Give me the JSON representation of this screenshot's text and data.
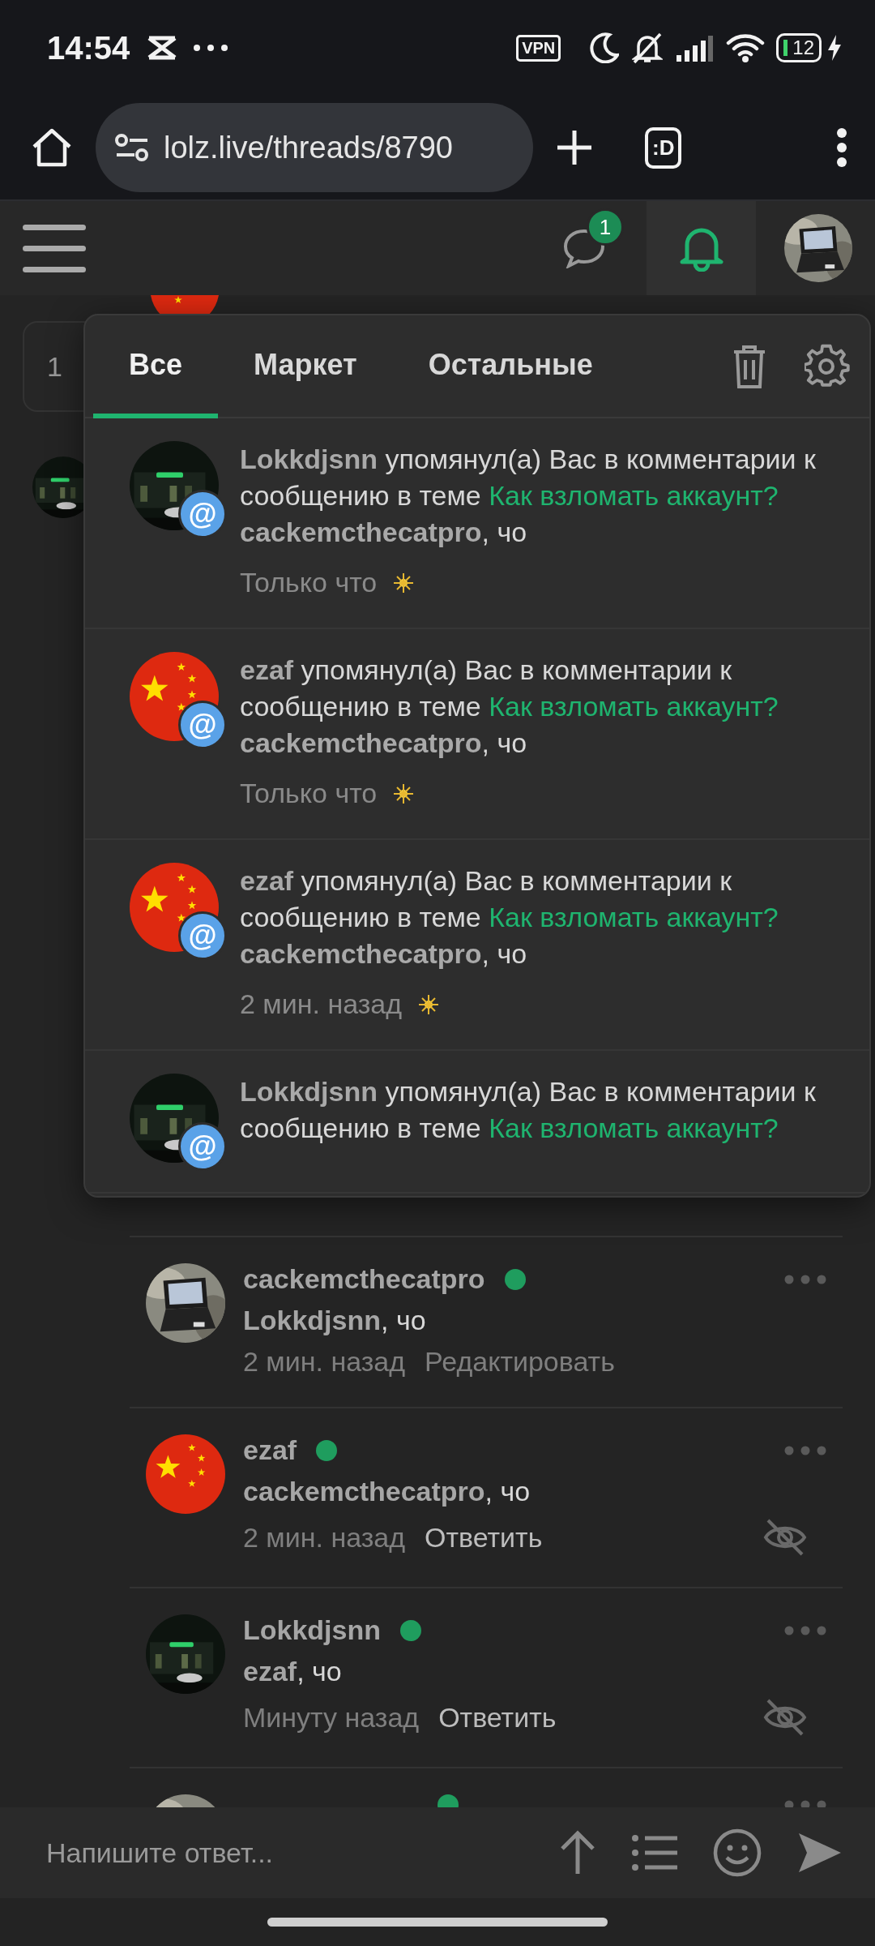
{
  "status_bar": {
    "time": "14:54",
    "vpn": "VPN",
    "battery": "12",
    "charging": true
  },
  "browser": {
    "url": "lolz.live/threads/8790",
    "tab_switcher": ":D"
  },
  "header": {
    "messages_badge": "1",
    "notifications_selected": true
  },
  "thread_behind": {
    "card_text": "1"
  },
  "popup": {
    "tabs": [
      {
        "label": "Все",
        "selected": true
      },
      {
        "label": "Маркет",
        "selected": false
      },
      {
        "label": "Остальные",
        "selected": false
      }
    ],
    "notifications": [
      {
        "badge": "@",
        "author": "Lokkdjsnn",
        "action": "упомянул(а) Вас в комментарии к сообщению в теме",
        "thread": "Как взломать аккаунт?",
        "quote": "**cackemcthecatpro**, чо",
        "time": "Только что"
      },
      {
        "avatar": {
          "kind": "flag"
        },
        "badge": "@",
        "author": "ezaf",
        "action": "упомянул(а) Вас в комментарии к сообщению в теме",
        "thread": "Как взломать аккаунт?",
        "quote": "**cackemcthecatpro**, чо",
        "time": "Только что"
      },
      {
        "avatar": {
          "kind": "flag"
        },
        "badge": "@",
        "author": "ezaf",
        "action": "упомянул(а) Вас в комментарии к сообщению в теме",
        "thread": "Как взломать аккаунт?",
        "quote": "**cackemcthecatpro**, чо",
        "time": "2 мин. назад"
      },
      {
        "badge": "@",
        "author": "Lokkdjsnn",
        "action": "упомянул(а) Вас в комментарии к сообщению в теме",
        "thread": "Как взломать аккаунт?"
      }
    ]
  },
  "comments": [
    {
      "avatar": {
        "kind": "laptop"
      },
      "author": "cackemcthecatpro",
      "online": true,
      "text": "**Lokkdjsnn**, чо",
      "time": "2 мин. назад",
      "action": {
        "kind": "edit",
        "label": "Редактировать"
      },
      "hide_button": false
    },
    {
      "avatar": {
        "kind": "flag"
      },
      "author": "ezaf",
      "online": true,
      "text": "**cackemcthecatpro**, чо",
      "time": "2 мин. назад",
      "action": {
        "kind": "reply",
        "label": "Ответить"
      },
      "hide_button": true
    },
    {
      "author": "Lokkdjsnn",
      "online": true,
      "text": "**ezaf**, чо",
      "time": "Минуту назад",
      "action": {
        "kind": "reply",
        "label": "Ответить"
      },
      "hide_button": true
    },
    {
      "avatar": {
        "kind": "laptop"
      },
      "online": true
    }
  ],
  "composer": {
    "placeholder": "Напишите ответ..."
  }
}
